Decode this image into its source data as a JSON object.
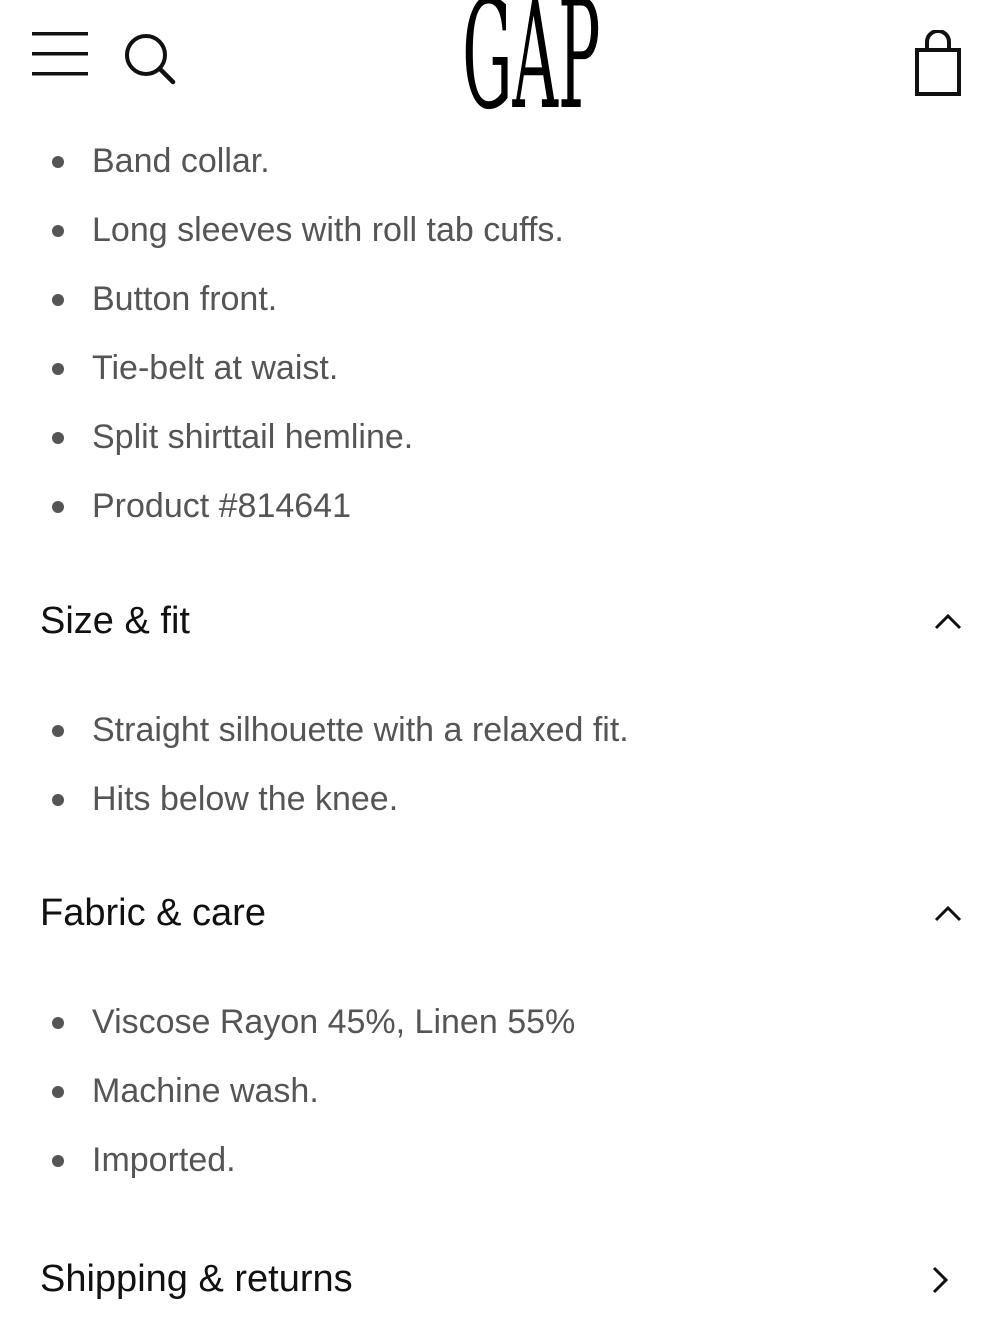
{
  "header": {
    "brand": "GAP",
    "menu_icon": "hamburger-menu-icon",
    "search_icon": "search-icon",
    "bag_icon": "shopping-bag-icon"
  },
  "details": {
    "items": [
      "Band collar.",
      "Long sleeves with roll tab cuffs.",
      "Button front.",
      "Tie-belt at waist.",
      "Split shirttail hemline.",
      "Product #814641"
    ]
  },
  "size_fit": {
    "title": "Size & fit",
    "state_icon": "chevron-up-icon",
    "items": [
      "Straight silhouette with a relaxed fit.",
      "Hits below the knee."
    ]
  },
  "fabric_care": {
    "title": "Fabric & care",
    "state_icon": "chevron-up-icon",
    "items": [
      "Viscose Rayon 45%, Linen 55%",
      "Machine wash.",
      "Imported."
    ]
  },
  "shipping_returns": {
    "title": "Shipping & returns",
    "state_icon": "chevron-right-icon"
  }
}
